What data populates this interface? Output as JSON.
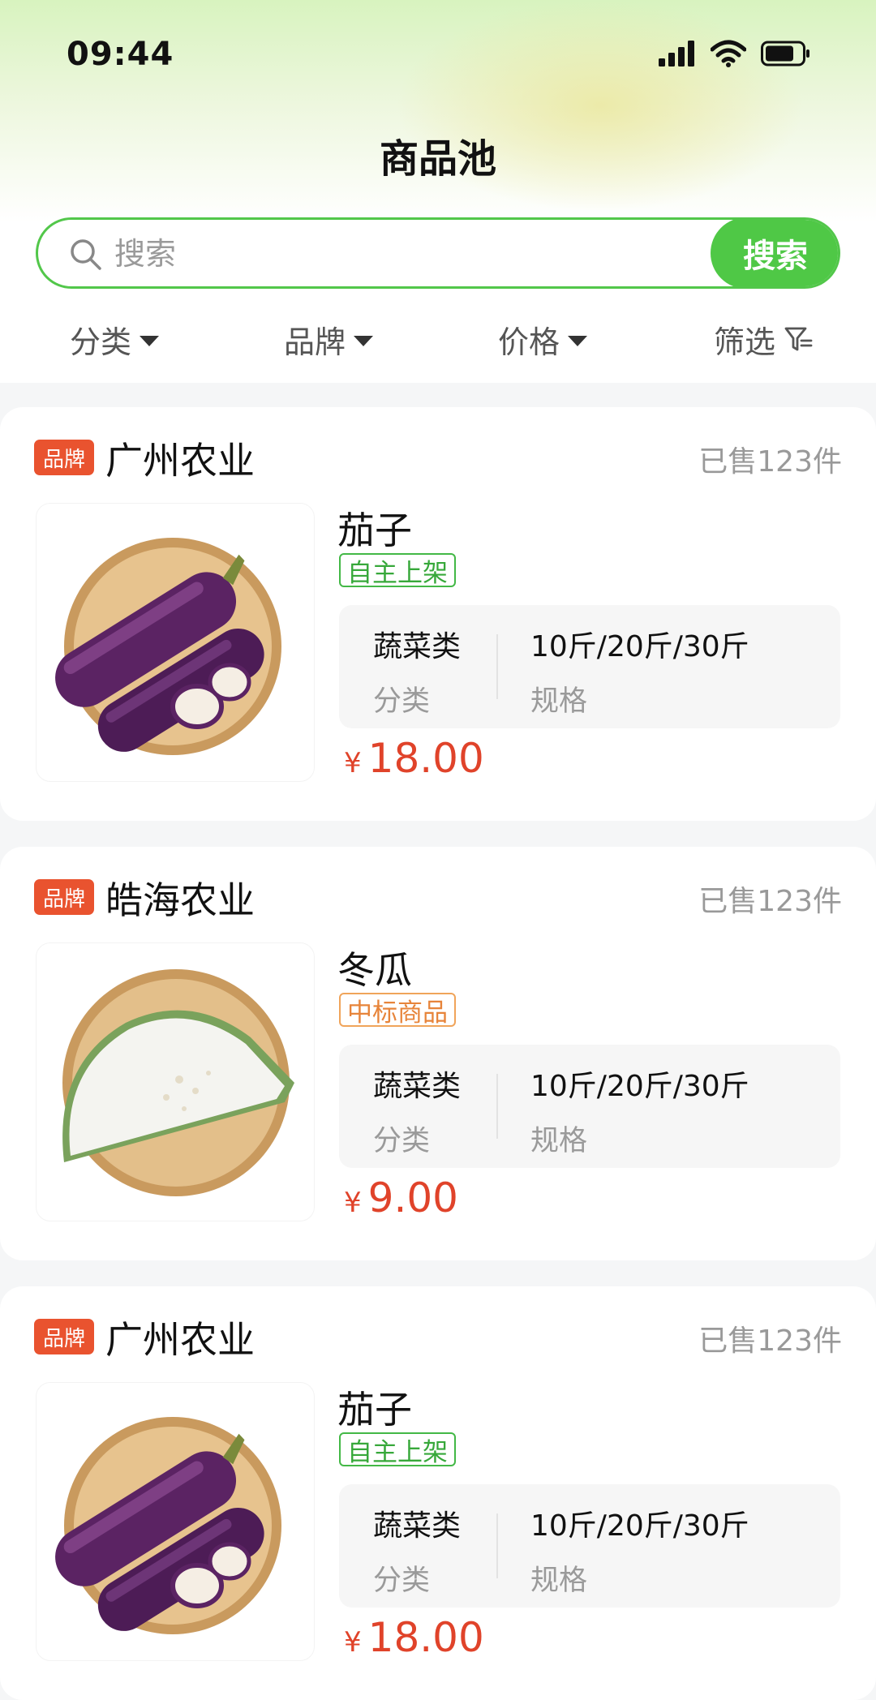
{
  "status_bar": {
    "time": "09:44",
    "icons": [
      "signal-icon",
      "wifi-icon",
      "battery-icon"
    ]
  },
  "header": {
    "title": "商品池"
  },
  "search": {
    "placeholder": "搜索",
    "button_label": "搜索"
  },
  "filters": [
    {
      "label": "分类",
      "icon": "caret-down-icon"
    },
    {
      "label": "品牌",
      "icon": "caret-down-icon"
    },
    {
      "label": "价格",
      "icon": "caret-down-icon"
    },
    {
      "label": "筛选",
      "icon": "filter-icon"
    }
  ],
  "products": [
    {
      "brand_badge": "品牌",
      "brand_name": "广州农业",
      "sold": "已售123件",
      "name": "茄子",
      "tag": "自主上架",
      "tag_style": "green",
      "category_value": "蔬菜类",
      "category_label": "分类",
      "spec_value": "10斤/20斤/30斤",
      "spec_label": "规格",
      "currency": "¥",
      "price": "18.00",
      "image": "eggplant"
    },
    {
      "brand_badge": "品牌",
      "brand_name": "皓海农业",
      "sold": "已售123件",
      "name": "冬瓜",
      "tag": "中标商品",
      "tag_style": "orange",
      "category_value": "蔬菜类",
      "category_label": "分类",
      "spec_value": "10斤/20斤/30斤",
      "spec_label": "规格",
      "currency": "¥",
      "price": "9.00",
      "image": "winter-melon"
    },
    {
      "brand_badge": "品牌",
      "brand_name": "广州农业",
      "sold": "已售123件",
      "name": "茄子",
      "tag": "自主上架",
      "tag_style": "green",
      "category_value": "蔬菜类",
      "category_label": "分类",
      "spec_value": "10斤/20斤/30斤",
      "spec_label": "规格",
      "currency": "¥",
      "price": "18.00",
      "image": "eggplant"
    }
  ],
  "colors": {
    "accent_green": "#4fc846",
    "brand_badge": "#e9532f",
    "price": "#e0432a",
    "tag_orange": "#e7843a"
  }
}
